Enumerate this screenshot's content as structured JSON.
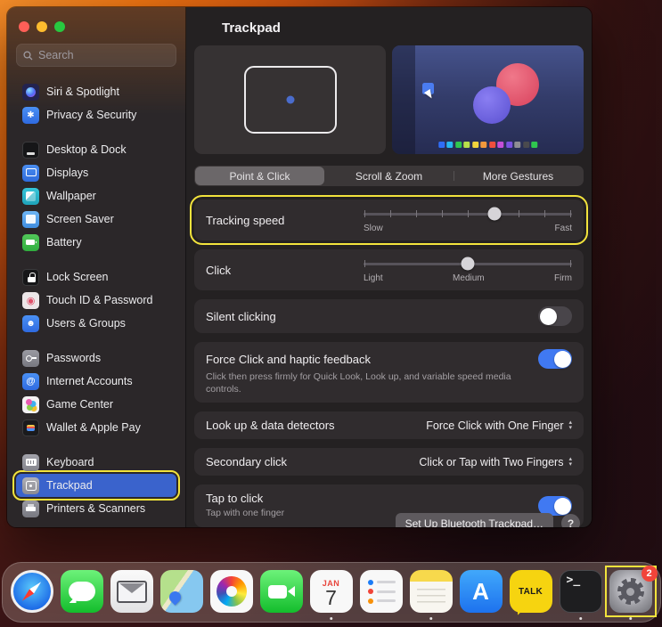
{
  "annotations": {
    "color": "#f2e33c",
    "highlighted": [
      "sidebar-item-trackpad",
      "tracking-speed-row",
      "dock-item-settings"
    ]
  },
  "window": {
    "title": "Trackpad"
  },
  "sidebar": {
    "search": {
      "placeholder": "Search"
    },
    "groups": [
      {
        "items": [
          {
            "label": "Siri & Spotlight",
            "icon": "siri-icon"
          },
          {
            "label": "Privacy & Security",
            "icon": "privacy-icon"
          }
        ]
      },
      {
        "items": [
          {
            "label": "Desktop & Dock",
            "icon": "desktop-dock-icon"
          },
          {
            "label": "Displays",
            "icon": "displays-icon"
          },
          {
            "label": "Wallpaper",
            "icon": "wallpaper-icon"
          },
          {
            "label": "Screen Saver",
            "icon": "screen-saver-icon"
          },
          {
            "label": "Battery",
            "icon": "battery-icon"
          }
        ]
      },
      {
        "items": [
          {
            "label": "Lock Screen",
            "icon": "lock-screen-icon"
          },
          {
            "label": "Touch ID & Password",
            "icon": "touch-id-icon"
          },
          {
            "label": "Users & Groups",
            "icon": "users-groups-icon"
          }
        ]
      },
      {
        "items": [
          {
            "label": "Passwords",
            "icon": "passwords-icon"
          },
          {
            "label": "Internet Accounts",
            "icon": "internet-accounts-icon"
          },
          {
            "label": "Game Center",
            "icon": "game-center-icon"
          },
          {
            "label": "Wallet & Apple Pay",
            "icon": "wallet-icon"
          }
        ]
      },
      {
        "items": [
          {
            "label": "Keyboard",
            "icon": "keyboard-icon"
          },
          {
            "label": "Trackpad",
            "icon": "trackpad-icon",
            "selected": true,
            "annotated": true
          },
          {
            "label": "Printers & Scanners",
            "icon": "printers-icon"
          }
        ]
      }
    ]
  },
  "previews": {
    "left": "trackpad-illustration",
    "right": "gesture-video-preview",
    "palette": [
      "#2f6df6",
      "#27b8f0",
      "#2fc74f",
      "#b8e04a",
      "#f2d43c",
      "#f2993c",
      "#ef4f3e",
      "#c44fd8",
      "#7a52e0",
      "#8e8e93",
      "#4a4a4e",
      "#2fc74f"
    ]
  },
  "tabs": [
    {
      "label": "Point & Click",
      "selected": true
    },
    {
      "label": "Scroll & Zoom",
      "selected": false
    },
    {
      "label": "More Gestures",
      "selected": false
    }
  ],
  "settings": {
    "tracking_speed": {
      "label": "Tracking speed",
      "min_label": "Slow",
      "max_label": "Fast",
      "value_percent": 63,
      "annotated": true
    },
    "click": {
      "label": "Click",
      "min_label": "Light",
      "mid_label": "Medium",
      "max_label": "Firm",
      "value_percent": 50
    },
    "silent_clicking": {
      "label": "Silent clicking",
      "enabled": false
    },
    "force_click": {
      "label": "Force Click and haptic feedback",
      "description": "Click then press firmly for Quick Look, Look up, and variable speed media controls.",
      "enabled": true
    },
    "look_up": {
      "label": "Look up & data detectors",
      "value": "Force Click with One Finger"
    },
    "secondary_click": {
      "label": "Secondary click",
      "value": "Click or Tap with Two Fingers"
    },
    "tap_to_click": {
      "label": "Tap to click",
      "description": "Tap with one finger",
      "enabled": true
    }
  },
  "footer": {
    "setup_button": "Set Up Bluetooth Trackpad…",
    "help_button": "?"
  },
  "dock": {
    "items": [
      {
        "name": "Safari"
      },
      {
        "name": "Messages"
      },
      {
        "name": "Mail"
      },
      {
        "name": "Maps"
      },
      {
        "name": "Photos"
      },
      {
        "name": "FaceTime"
      },
      {
        "name": "Calendar",
        "month": "JAN",
        "day": "7",
        "running": true
      },
      {
        "name": "Reminders"
      },
      {
        "name": "Notes",
        "running": true
      },
      {
        "name": "App Store",
        "letter": "A"
      },
      {
        "name": "Talk",
        "label": "TALK"
      },
      {
        "name": "Terminal",
        "glyph": "&gt;_",
        "running": true
      },
      {
        "name": "System Settings",
        "badge": "2",
        "annotated": true,
        "running": true
      }
    ]
  }
}
